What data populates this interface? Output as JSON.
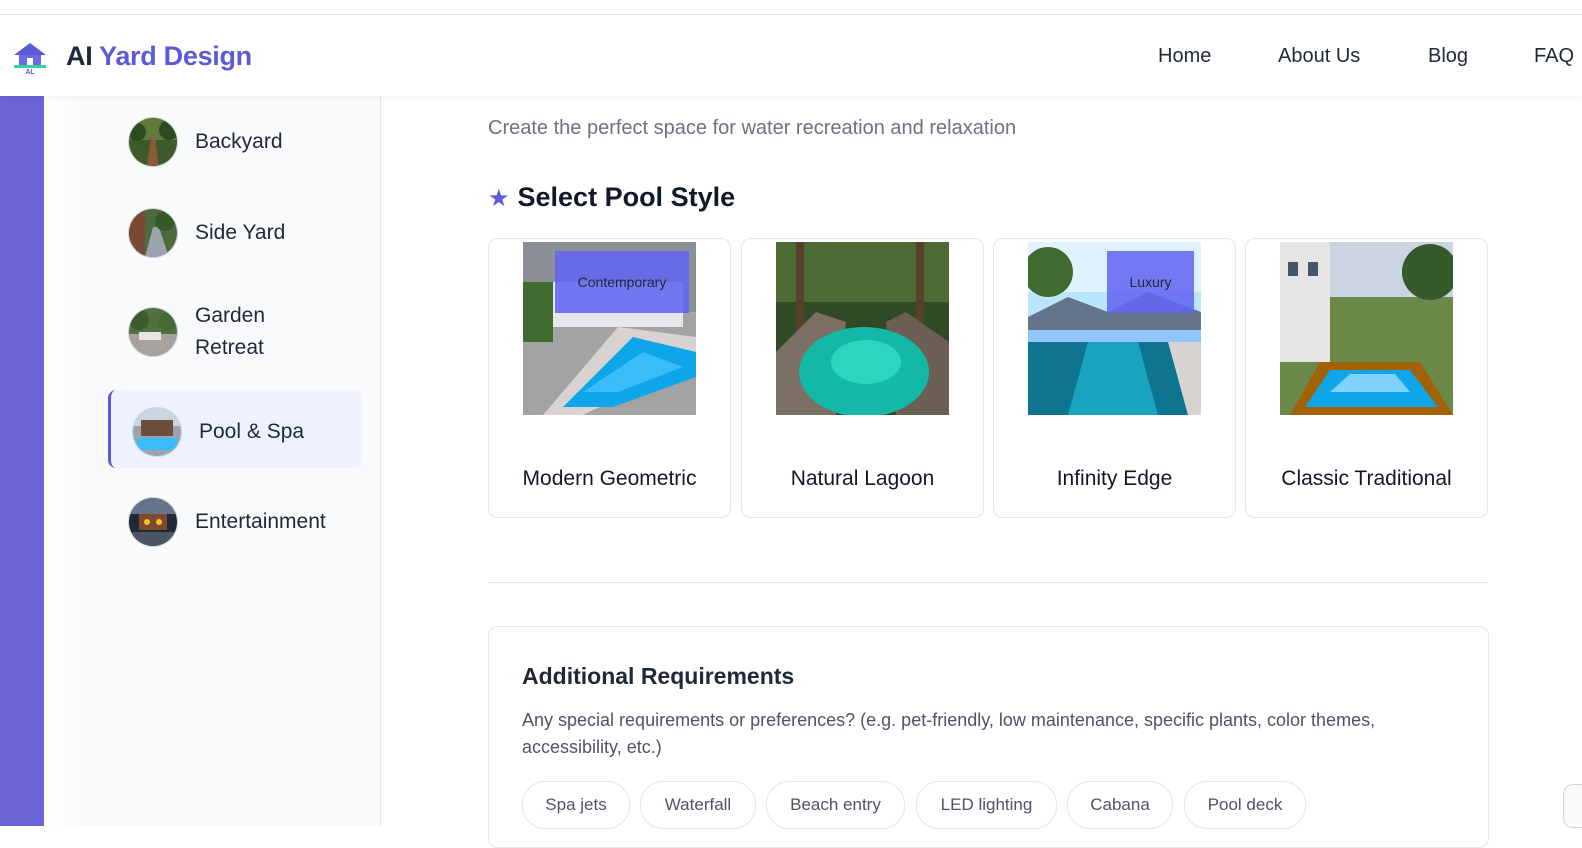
{
  "header": {
    "brand_ai": "AI",
    "brand_rest": "Yard Design",
    "logo_text": "AL",
    "nav": [
      "Home",
      "About Us",
      "Blog",
      "FAQ"
    ]
  },
  "sidebar": {
    "items": [
      {
        "label": "Backyard",
        "icon": "backyard-thumbnail"
      },
      {
        "label": "Side Yard",
        "icon": "side-yard-thumbnail"
      },
      {
        "label": "Garden Retreat",
        "icon": "garden-retreat-thumbnail"
      },
      {
        "label": "Pool & Spa",
        "icon": "pool-spa-thumbnail",
        "active": true
      },
      {
        "label": "Entertainment",
        "icon": "entertainment-thumbnail"
      }
    ]
  },
  "main": {
    "subtitle": "Create the perfect space for water recreation and relaxation",
    "section_title": "Select Pool Style",
    "styles": [
      {
        "name": "Modern Geometric",
        "badge": "Contemporary"
      },
      {
        "name": "Natural Lagoon",
        "badge": ""
      },
      {
        "name": "Infinity Edge",
        "badge": "Luxury"
      },
      {
        "name": "Classic Traditional",
        "badge": ""
      }
    ]
  },
  "requirements": {
    "title": "Additional Requirements",
    "description": "Any special requirements or preferences? (e.g. pet-friendly, low maintenance, specific plants, color themes, accessibility, etc.)",
    "chips": [
      "Spa jets",
      "Waterfall",
      "Beach entry",
      "LED lighting",
      "Cabana",
      "Pool deck"
    ]
  },
  "colors": {
    "accent": "#5b5bd6",
    "sidebar_bar": "#6b63d6",
    "active_bg": "#eef2ff"
  }
}
